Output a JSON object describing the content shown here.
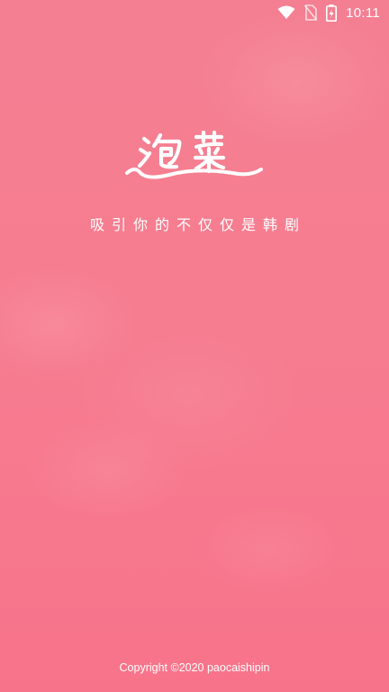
{
  "status_bar": {
    "time": "10:11",
    "icons": [
      "wifi-icon",
      "no-sim-icon",
      "battery-charging-icon"
    ]
  },
  "splash": {
    "logo_text": "泡菜",
    "slogan": "吸引你的不仅仅是韩剧",
    "copyright": "Copyright ©2020 paocaishipin"
  },
  "colors": {
    "background": "#f67d90",
    "text": "#ffffff"
  }
}
